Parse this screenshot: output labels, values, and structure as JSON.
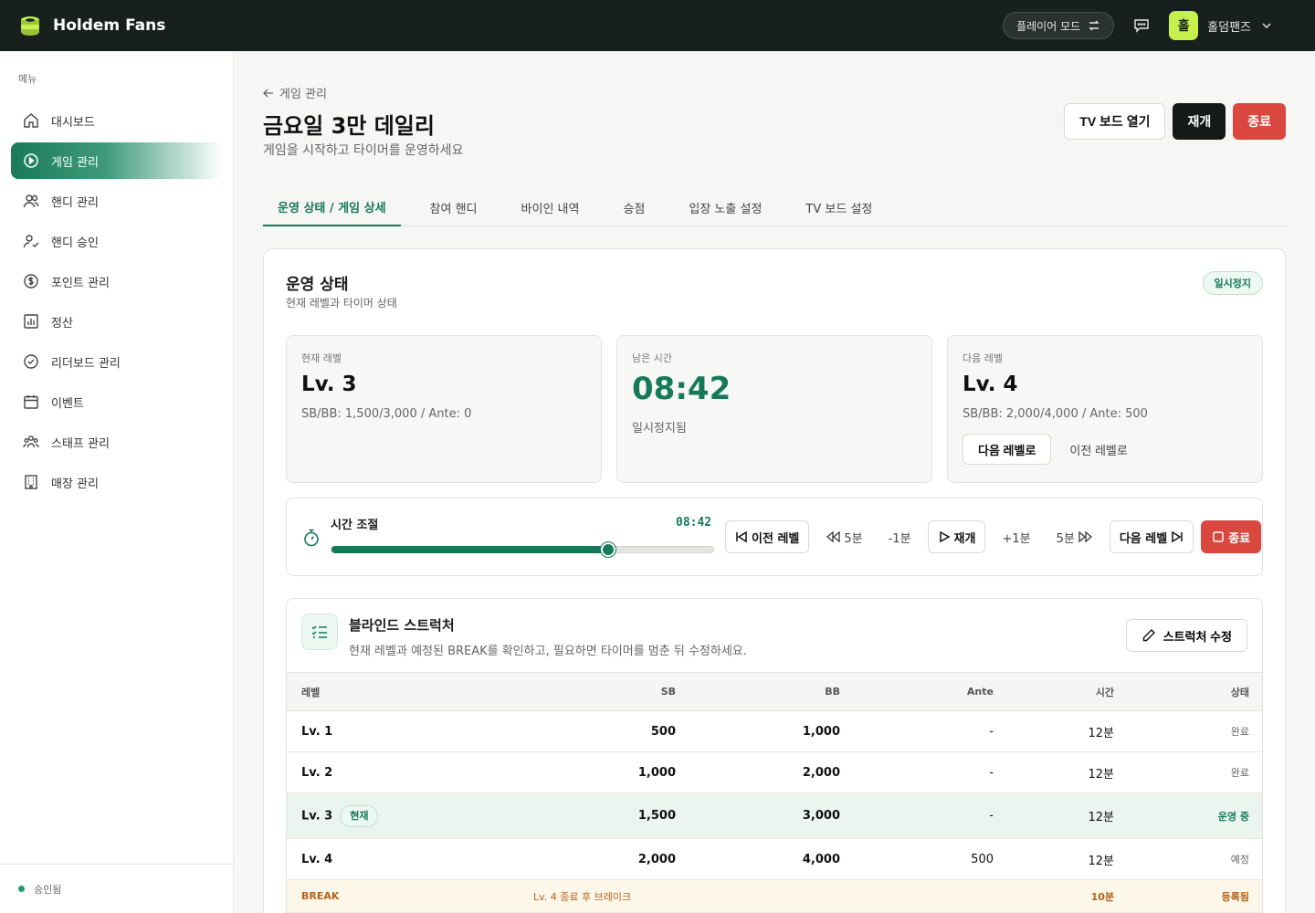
{
  "app": {
    "name": "Holdem Fans"
  },
  "topbar": {
    "mode_label": "플레이어 모드",
    "user_initial": "홀",
    "user_name": "홀덤팬즈"
  },
  "sidebar": {
    "menu_label": "메뉴",
    "items": [
      {
        "label": "대시보드",
        "icon": "home-icon"
      },
      {
        "label": "게임 관리",
        "icon": "play-circle-icon",
        "active": true
      },
      {
        "label": "핸디 관리",
        "icon": "users-icon"
      },
      {
        "label": "핸디 승인",
        "icon": "user-check-icon"
      },
      {
        "label": "포인트 관리",
        "icon": "dollar-icon"
      },
      {
        "label": "정산",
        "icon": "bar-chart-icon"
      },
      {
        "label": "리더보드 관리",
        "icon": "check-circle-icon"
      },
      {
        "label": "이벤트",
        "icon": "calendar-icon"
      },
      {
        "label": "스태프 관리",
        "icon": "team-icon"
      },
      {
        "label": "매장 관리",
        "icon": "building-icon"
      }
    ],
    "footer_status": "승인됨"
  },
  "header": {
    "back_label": "게임 관리",
    "title": "금요일 3만 데일리",
    "subtitle": "게임을 시작하고 타이머를 운영하세요",
    "tv_button": "TV 보드 열기",
    "resume_button": "재개",
    "end_button": "종료"
  },
  "tabs": [
    "운영 상태 / 게임 상세",
    "참여 핸디",
    "바이인 내역",
    "승점",
    "입장 노출 설정",
    "TV 보드 설정"
  ],
  "status": {
    "title": "운영 상태",
    "subtitle": "현재 레벨과 타이머 상태",
    "badge": "일시정지",
    "current": {
      "label": "현재 레벨",
      "value": "Lv. 3",
      "detail": "SB/BB: 1,500/3,000 / Ante: 0"
    },
    "remaining": {
      "label": "남은 시간",
      "value": "08:42",
      "detail": "일시정지됨"
    },
    "next": {
      "label": "다음 레벨",
      "value": "Lv. 4",
      "detail": "SB/BB: 2,000/4,000 / Ante: 500",
      "next_btn": "다음 레벨로",
      "prev_btn": "이전 레벨로"
    }
  },
  "time_control": {
    "label": "시간 조절",
    "time": "08:42",
    "progress": 0.725,
    "prev_level": "이전 레벨",
    "minus5": "5분",
    "minus1": "-1분",
    "resume": "재개",
    "plus1": "+1분",
    "plus5": "5분",
    "next_level": "다음 레벨",
    "end": "종료"
  },
  "blind": {
    "title": "블라인드 스트럭처",
    "subtitle": "현재 레벨과 예정된 BREAK를 확인하고, 필요하면 타이머를 멈춘 뒤 수정하세요.",
    "edit_button": "스트럭처 수정",
    "columns": [
      "레벨",
      "SB",
      "BB",
      "Ante",
      "시간",
      "상태"
    ],
    "current_badge": "현재",
    "rows": [
      {
        "level": "Lv. 1",
        "sb": "500",
        "bb": "1,000",
        "ante": "-",
        "time": "12분",
        "status": "완료"
      },
      {
        "level": "Lv. 2",
        "sb": "1,000",
        "bb": "2,000",
        "ante": "-",
        "time": "12분",
        "status": "완료"
      },
      {
        "level": "Lv. 3",
        "sb": "1,500",
        "bb": "3,000",
        "ante": "-",
        "time": "12분",
        "status": "운영 중"
      },
      {
        "level": "Lv. 4",
        "sb": "2,000",
        "bb": "4,000",
        "ante": "500",
        "time": "12분",
        "status": "예정"
      }
    ],
    "break_row": {
      "label": "BREAK",
      "note": "Lv. 4 종료 후 브레이크",
      "time": "10분",
      "status": "등록됨"
    }
  }
}
